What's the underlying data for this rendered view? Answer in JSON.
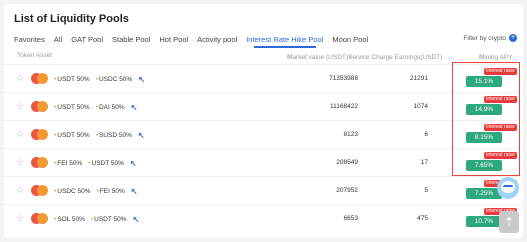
{
  "title": "List of Liquidity Pools",
  "tabs": [
    "Favorites",
    "All",
    "GAT Pool",
    "Stable Pool",
    "Hot Pool",
    "Activity pool",
    "Interest Rate Hike Pool",
    "Moon Pool"
  ],
  "filter_label": "Filter by crypto",
  "columns": {
    "token_asset": "Token Asset",
    "market_value": "Market value (USDT)",
    "service_charge": "Service Charge Earnings(USDT)",
    "mining_apy": "Mining APY"
  },
  "badge_label": "Interest raise",
  "rows": [
    {
      "token_a": "USDT 50%",
      "token_b": "USDC 50%",
      "market_value": "71353988",
      "service_charge": "21291",
      "apy": "15.1%"
    },
    {
      "token_a": "USDT 50%",
      "token_b": "DAI 50%",
      "market_value": "11168422",
      "service_charge": "1074",
      "apy": "14.9%"
    },
    {
      "token_a": "USDT 50%",
      "token_b": "SUSD 50%",
      "market_value": "8123",
      "service_charge": "6",
      "apy": "8.15%"
    },
    {
      "token_a": "FEI 50%",
      "token_b": "USDT 50%",
      "market_value": "208549",
      "service_charge": "17",
      "apy": "7.65%"
    },
    {
      "token_a": "USDC 50%",
      "token_b": "FEI 50%",
      "market_value": "207952",
      "service_charge": "5",
      "apy": "7.25%"
    },
    {
      "token_a": "SOL 50%",
      "token_b": "USDT 50%",
      "market_value": "6653",
      "service_charge": "475",
      "apy": "10.7%"
    }
  ],
  "colors": {
    "accent": "#2f6bd8",
    "apy_green": "#2fa880",
    "badge_red": "#e43b3b",
    "highlight_box": "#e4473b"
  },
  "icons": {
    "favorite": "star-icon",
    "swap": "bolt-icon",
    "chatbot": "assistant-avatar-icon",
    "back_to_top": "arrow-up-icon"
  }
}
